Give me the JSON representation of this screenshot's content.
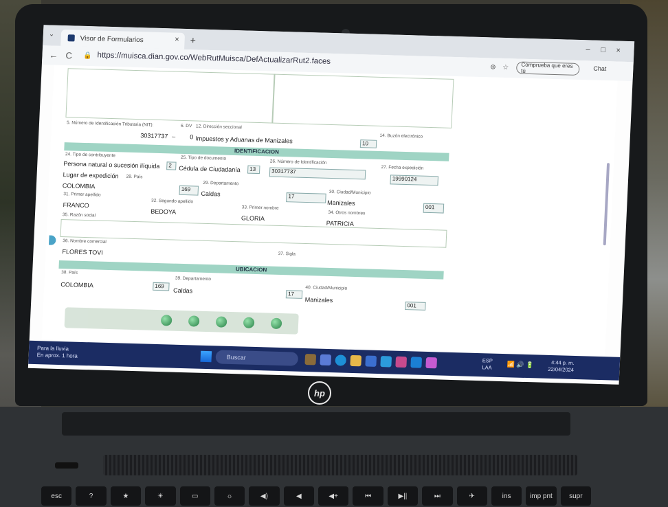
{
  "browser": {
    "tab_title": "Visor de Formularios",
    "tab_close": "×",
    "new_tab": "+",
    "url": "https://muisca.dian.gov.co/WebRutMuisca/DefActualizarRut2.faces",
    "back": "←",
    "reload": "C",
    "profile_label": "Comprueba que eres tú",
    "chat_label": "Chat",
    "minimize": "–",
    "maximize": "□",
    "close": "×"
  },
  "form": {
    "field5_label": "5. Número de Identificación Tributaria (NIT):",
    "field5_value": "30317737",
    "field6_label": "6. DV",
    "field12_label": "12. Dirección seccional",
    "field12_value": "Impuestos y Aduanas de Manizales",
    "field12_code": "10",
    "field14_label": "14. Buzón electrónico",
    "section_identificacion": "IDENTIFICACION",
    "field24_label": "24. Tipo de contribuyente",
    "field24_value": "Persona natural o sucesión ilíquida",
    "field24_code": "2",
    "field25_label": "25. Tipo de documento",
    "field25_value": "Cédula de Ciudadanía",
    "field25_code": "13",
    "field26_label": "26. Número de Identificación",
    "field26_value": "30317737",
    "field27_label": "27. Fecha expedición",
    "field27_value": "19990124",
    "lugar_label": "Lugar de expedición",
    "field28_label": "28. País",
    "field28_value": "COLOMBIA",
    "field28_code": "169",
    "field29_label": "29. Departamento",
    "field29_value": "Caldas",
    "field29_code": "17",
    "field30_label": "30. Ciudad/Municipio",
    "field30_value": "Manizales",
    "field30_code": "001",
    "field31_label": "31. Primer apellido",
    "field31_value": "FRANCO",
    "field32_label": "32. Segundo apellido",
    "field32_value": "BEDOYA",
    "field33_label": "33. Primer nombre",
    "field33_value": "GLORIA",
    "field34_label": "34. Otros nombres",
    "field34_value": "PATRICIA",
    "field35_label": "35. Razón social",
    "field36_label": "36. Nombre comercial",
    "field36_value": "FLORES TOVI",
    "field37_label": "37. Sigla",
    "section_ubicacion": "UBICACION",
    "field38_label": "38. País",
    "field38_value": "COLOMBIA",
    "field38_code": "169",
    "field39_label": "39. Departamento",
    "field39_value": "Caldas",
    "field39_code": "17",
    "field40_label": "40. Ciudad/Municipio",
    "field40_value": "Manizales",
    "field40_code": "001",
    "field_dv_value": "0",
    "dash": "–"
  },
  "taskbar": {
    "weather_line1": "Para la lluvia",
    "weather_line2": "En aprox. 1 hora",
    "search_placeholder": "Buscar",
    "lang_line1": "ESP",
    "lang_line2": "LAA",
    "clock_time": "4:44 p. m.",
    "clock_date": "22/04/2024"
  },
  "laptop": {
    "brand": "hp",
    "keys": [
      "esc",
      "?",
      "★",
      "☀",
      "▭",
      "☼",
      "◀)",
      "◀",
      "◀+",
      "⏮",
      "▶||",
      "⏭",
      "✈",
      "ins",
      "imp pnt",
      "supr"
    ]
  }
}
